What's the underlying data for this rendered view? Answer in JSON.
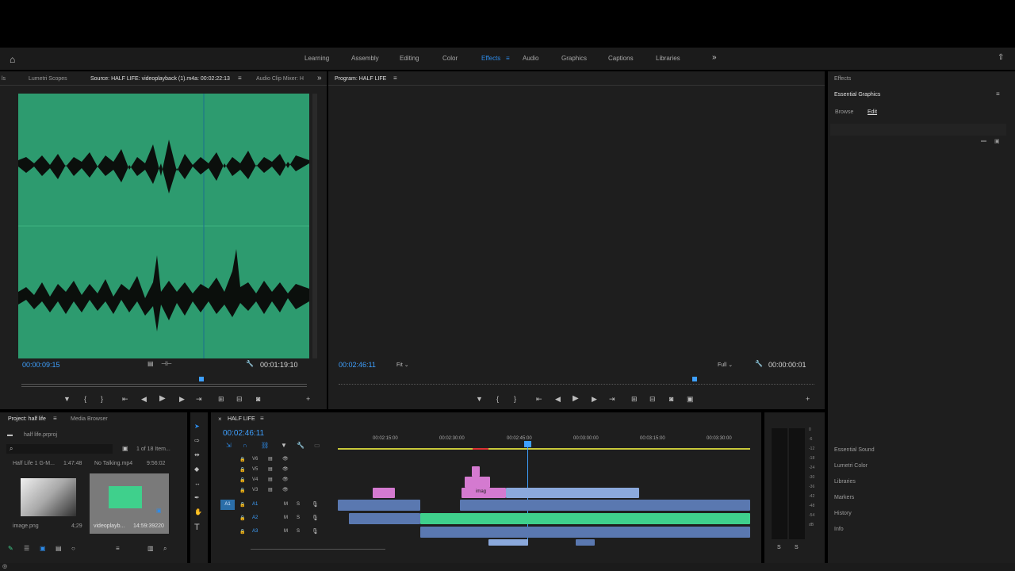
{
  "workspaces": [
    "Learning",
    "Assembly",
    "Editing",
    "Color",
    "Effects",
    "Audio",
    "Graphics",
    "Captions",
    "Libraries"
  ],
  "active_workspace": "Effects",
  "source_panel": {
    "tabs": [
      "ls",
      "Lumetri Scopes",
      "Source: HALF LIFE: videoplayback (1).m4a: 00:02:22:13",
      "Audio Clip Mixer: H"
    ],
    "timecode_left": "00:00:09:15",
    "timecode_right": "00:01:19:10"
  },
  "program_panel": {
    "title": "Program: HALF LIFE",
    "timecode_left": "00:02:46:11",
    "fit": "Fit",
    "quality": "Full",
    "timecode_right": "00:00:00:01"
  },
  "effects_panel": {
    "header": "Effects",
    "title": "Essential Graphics",
    "tabs": [
      "Browse",
      "Edit"
    ],
    "list": [
      "Essential Sound",
      "Lumetri Color",
      "Libraries",
      "Markers",
      "History",
      "Info"
    ]
  },
  "project_panel": {
    "tabs": [
      "Project: half life",
      "Media Browser"
    ],
    "file": "half life.prproj",
    "count": "1 of 18 Item...",
    "header_left": "Half Life 1 G-M...",
    "header_time": "1:47:48",
    "header_name": "No Talking.mp4",
    "header_time2": "9:56:02",
    "items": [
      {
        "name": "image.png",
        "duration": "4;29"
      },
      {
        "name": "videoplayb...",
        "duration": "14:59:39220"
      }
    ]
  },
  "timeline": {
    "name": "HALF LIFE",
    "timecode": "00:02:46:11",
    "ruler": [
      "00:02:15:00",
      "00:02:30:00",
      "00:02:45:00",
      "00:03:00:00",
      "00:03:15:00",
      "00:03:30:00"
    ],
    "video_tracks": [
      "V6",
      "V5",
      "V4",
      "V3"
    ],
    "audio_tracks": [
      "A1",
      "A2",
      "A3"
    ],
    "source_patch": "A1",
    "clip_label": "imag"
  },
  "meter_scale": [
    "0",
    "-6",
    "-12",
    "-18",
    "-24",
    "-30",
    "-36",
    "-42",
    "-48",
    "-54",
    "dB"
  ],
  "meter_buttons": [
    "S",
    "S"
  ],
  "colors": {
    "accent": "#2d8ceb",
    "waveform_bg": "#2d9b6f",
    "video_clip": "#d47ad0",
    "audio_clip": "#6f8fc6",
    "audio_green": "#3fd08c"
  }
}
